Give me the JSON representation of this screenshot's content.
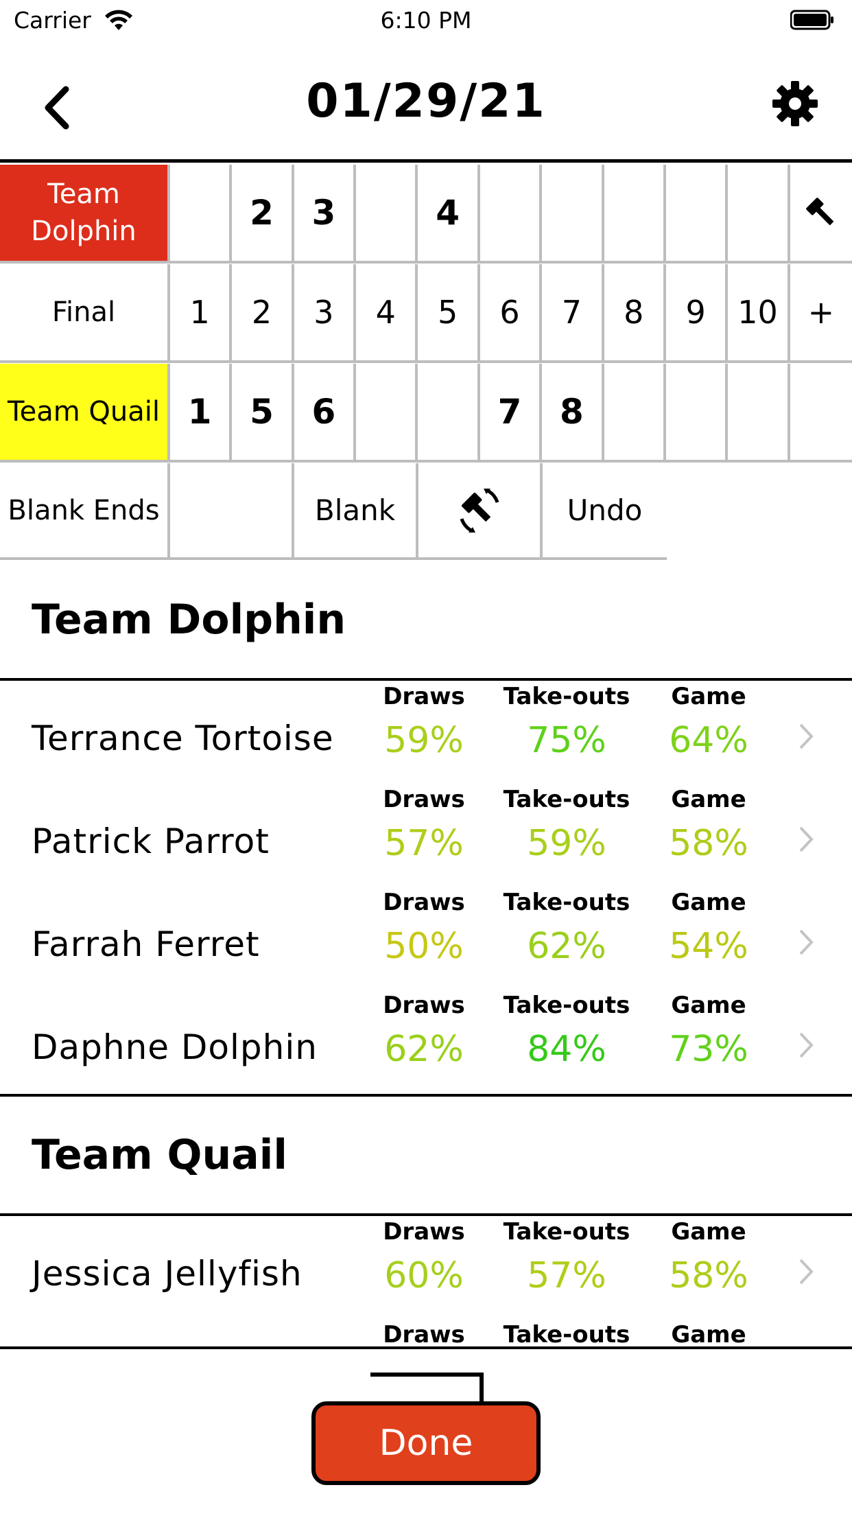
{
  "status_bar": {
    "carrier": "Carrier",
    "time": "6:10 PM"
  },
  "nav": {
    "title": "01/29/21",
    "back_icon": "chevron-left-icon",
    "settings_icon": "gear-icon"
  },
  "scoreboard": {
    "team_top": {
      "name": "Team Dolphin",
      "color": "#dd2e1c",
      "ends": [
        "",
        "2",
        "3",
        "",
        "4",
        "",
        "",
        "",
        "",
        ""
      ],
      "extra_icon": "hammer-icon"
    },
    "final_row": {
      "label": "Final",
      "ends": [
        "1",
        "2",
        "3",
        "4",
        "5",
        "6",
        "7",
        "8",
        "9",
        "10"
      ],
      "add": "+"
    },
    "team_bottom": {
      "name": "Team Quail",
      "color": "#ffff1a",
      "ends": [
        "1",
        "5",
        "6",
        "",
        "",
        "7",
        "8",
        "",
        "",
        ""
      ]
    },
    "actions": {
      "label": "Blank Ends",
      "blank": "Blank",
      "hammer_icon": "hammer-rotate-icon",
      "undo": "Undo"
    }
  },
  "teams": [
    {
      "name": "Team Dolphin",
      "players": [
        {
          "name": "Terrance Tortoise",
          "draws": "59%",
          "takeouts": "75%",
          "game": "64%",
          "colors": [
            "#a9cf1c",
            "#5ed11a",
            "#7ed21b"
          ]
        },
        {
          "name": "Patrick Parrot",
          "draws": "57%",
          "takeouts": "59%",
          "game": "58%",
          "colors": [
            "#b2cc18",
            "#a9cf1c",
            "#aecd1a"
          ]
        },
        {
          "name": "Farrah Ferret",
          "draws": "50%",
          "takeouts": "62%",
          "game": "54%",
          "colors": [
            "#c6c814",
            "#9acf1b",
            "#bac916"
          ]
        },
        {
          "name": "Daphne Dolphin",
          "draws": "62%",
          "takeouts": "84%",
          "game": "73%",
          "colors": [
            "#9acf1b",
            "#35c919",
            "#61d11a"
          ]
        }
      ]
    },
    {
      "name": "Team Quail",
      "players": [
        {
          "name": "Jessica Jellyfish",
          "draws": "60%",
          "takeouts": "57%",
          "game": "58%",
          "colors": [
            "#a6cf1c",
            "#b2cc18",
            "#aecd1a"
          ]
        }
      ]
    }
  ],
  "stat_labels": {
    "draws": "Draws",
    "takeouts": "Take-outs",
    "game": "Game"
  },
  "footer": {
    "done": "Done"
  }
}
